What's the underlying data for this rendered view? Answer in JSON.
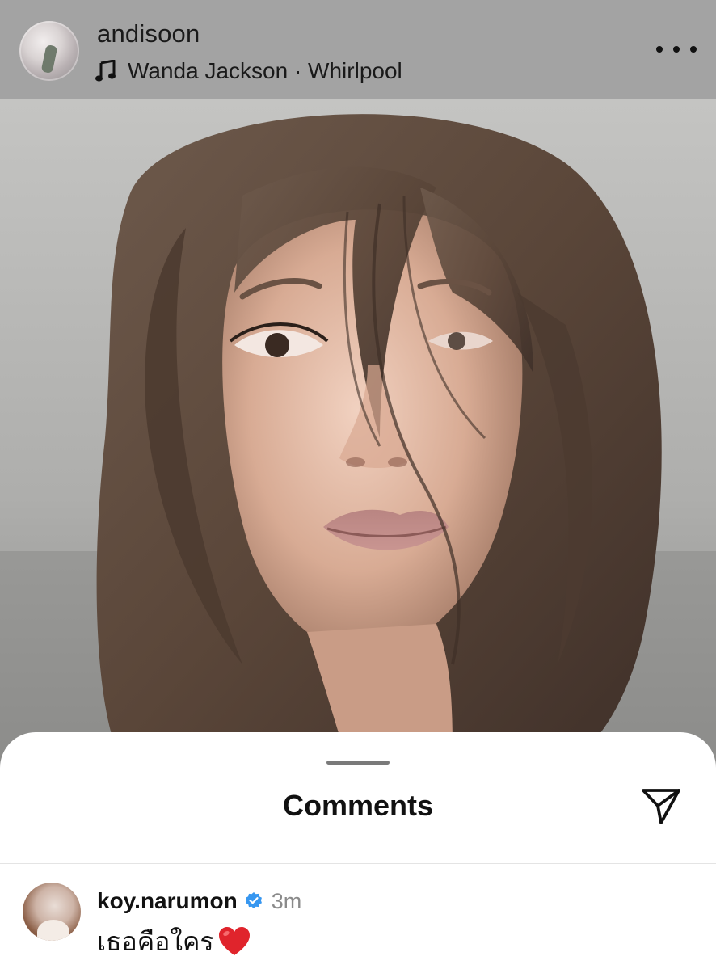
{
  "post_header": {
    "username": "andisoon",
    "music": "Wanda Jackson · Whirlpool",
    "avatar_icon": "profile-avatar",
    "music_icon": "music-note-icon",
    "more_icon": "more-options-icon"
  },
  "photo": {
    "icon": "post-photo"
  },
  "comments_sheet": {
    "title": "Comments",
    "share_icon": "send-icon"
  },
  "comments": [
    {
      "username": "koy.narumon",
      "verified": true,
      "time": "3m",
      "text": "เธอคือใคร",
      "emoji_icon": "red-heart-icon"
    }
  ],
  "colors": {
    "header_bg": "#a3a3a3",
    "sheet_bg": "#ffffff",
    "verified_blue": "#3797f0",
    "heart_red": "#e0242c",
    "muted_text": "#8a8a8a"
  }
}
